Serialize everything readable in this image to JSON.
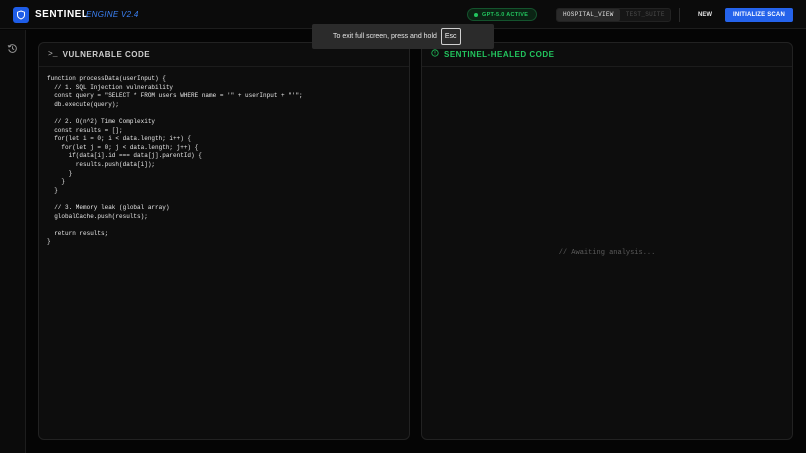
{
  "header": {
    "brand": "SENTINEL",
    "brand_sub": "ENGINE V2.4",
    "status": "GPT-5.0 ACTIVE",
    "tabs": [
      {
        "label": "HOSPITAL_VIEW",
        "active": true
      },
      {
        "label": "TEST_SUITE",
        "active": false
      }
    ],
    "new_label": "NEW",
    "scan_label": "INITIALIZE SCAN",
    "colors": {
      "accent": "#2563eb",
      "status": "#22c55e"
    }
  },
  "sidebar": {
    "items": [
      {
        "icon": "history-icon"
      }
    ]
  },
  "left_panel": {
    "icon": ">_",
    "title": "VULNERABLE CODE",
    "code": "function processData(userInput) {\n  // 1. SQL Injection vulnerability\n  const query = \"SELECT * FROM users WHERE name = '\" + userInput + \"'\";\n  db.execute(query);\n\n  // 2. O(n^2) Time Complexity\n  const results = [];\n  for(let i = 0; i < data.length; i++) {\n    for(let j = 0; j < data.length; j++) {\n      if(data[i].id === data[j].parentId) {\n        results.push(data[i]);\n      }\n    }\n  }\n\n  // 3. Memory leak (global array)\n  globalCache.push(results);\n\n  return results;\n}"
  },
  "right_panel": {
    "icon": "shield-icon",
    "title": "SENTINEL-HEALED CODE",
    "placeholder": "// Awaiting analysis..."
  },
  "toast": {
    "text": "To exit full screen, press and hold",
    "key": "Esc"
  }
}
